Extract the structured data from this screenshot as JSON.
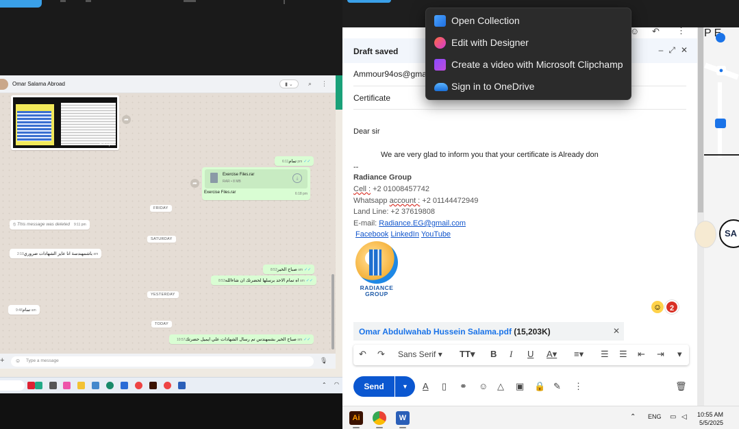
{
  "colors": {
    "whatsapp_out_bubble": "#d9fdd3",
    "gmail_send_blue": "#0b57d0",
    "link_blue": "#1155cc",
    "badge_red": "#d93025",
    "menu_bg": "#2b2b2b"
  },
  "context_menu": {
    "items": [
      {
        "label": "Open Collection",
        "icon": "collection-icon"
      },
      {
        "label": "Edit with Designer",
        "icon": "designer-icon"
      },
      {
        "label": "Create a video with Microsoft Clipchamp",
        "icon": "clipchamp-icon"
      },
      {
        "label": "Sign in to OneDrive",
        "icon": "onedrive-icon"
      }
    ]
  },
  "whatsapp": {
    "contact_name": "Omar Salama Abroad",
    "thumb_time": "5:42 pm",
    "messages": {
      "m1": {
        "text": "تمام",
        "time": "6:11 pm"
      },
      "file_name": "Exercise Files.rar",
      "file_meta": "RAR • 8 MB",
      "file_caption": "Exercise Files.rar",
      "file_time": "6:18 pm",
      "day1": "FRIDAY",
      "deleted": {
        "text": "This message was deleted",
        "time": "9:11 pm"
      },
      "day2": "SATURDAY",
      "m2": {
        "text": "باشمهندسة انا عايز الشهادات ضروري",
        "time": "2:10 am"
      },
      "m3": {
        "text": "صباح الخير",
        "time": "8:53 am"
      },
      "m4": {
        "text": "اه تمام الاحد برسلها لحضرتك ان شاءالله",
        "time": "8:53 am"
      },
      "day3": "YESTERDAY",
      "m5": {
        "text": "تمام",
        "time": "9:48 am"
      },
      "day4": "TODAY",
      "m6": {
        "text": "صباح الخير بشمهندس تم رسال الشهادات علي ايميل حضرتك",
        "time": "10:57 am"
      }
    },
    "input_placeholder": "Type a message"
  },
  "gmail": {
    "header_title": "Draft saved",
    "to": "Ammour94os@gma",
    "subject": "Certificate",
    "body": {
      "greeting": "Dear sir",
      "line": "We are very glad to inform you that your certificate is Already don",
      "sig_sep": "--",
      "company": "Radiance Group",
      "cell_label": "Cell :",
      "cell_value": " +2 01008457742",
      "whatsapp_label_a": "Whatsapp ",
      "whatsapp_label_b": "account :",
      "whatsapp_value": " +2 01144472949",
      "landline": "Land Line: +2 37619808",
      "email_label": "E-mail: ",
      "email_value": "Radiance.EG@gmail.com",
      "social": [
        "Facebook",
        "LinkedIn",
        "YouTube"
      ]
    },
    "logo_text_1": "RADIANCE",
    "logo_text_2": "GROUP",
    "badge_count": "2",
    "attachment_name": "Omar Abdulwahab Hussein Salama.pdf",
    "attachment_size": "(15,203K)",
    "font_name": "Sans Serif",
    "send_label": "Send"
  },
  "taskbar": {
    "language": "ENG",
    "time": "10:55 AM",
    "date": "5/5/2025"
  }
}
